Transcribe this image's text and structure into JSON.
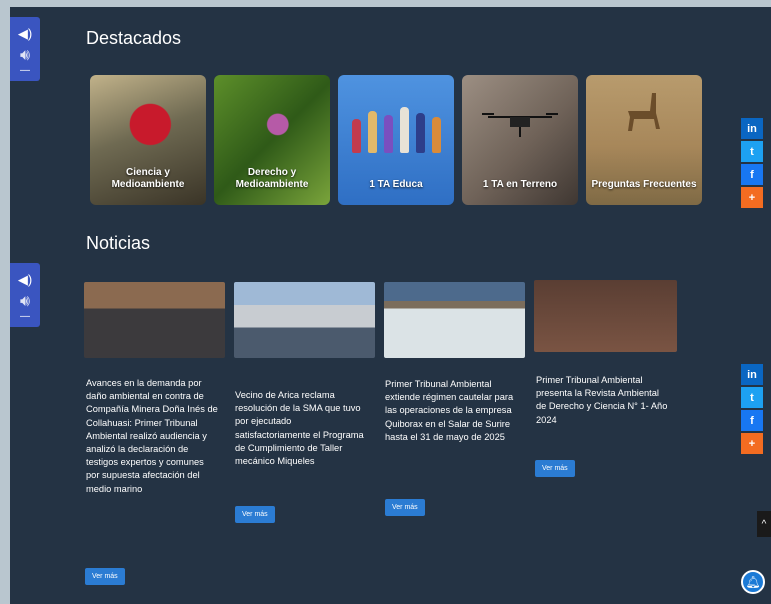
{
  "sections": {
    "featured_title": "Destacados",
    "news_title": "Noticias"
  },
  "accessibility": {
    "icon": "speaker-icon"
  },
  "featured": [
    {
      "label": "Ciencia y Medioambiente"
    },
    {
      "label": "Derecho y Medioambiente"
    },
    {
      "label": "1 TA Educa"
    },
    {
      "label": "1 TA en Terreno"
    },
    {
      "label": "Preguntas Frecuentes"
    }
  ],
  "news": [
    {
      "text": "Avances en la demanda por daño ambiental en contra de Compañía Minera Doña Inés de Collahuasi: Primer Tribunal Ambiental realizó audiencia y analizó la declaración de testigos expertos y comunes por supuesta afectación del medio marino",
      "button": "Ver más"
    },
    {
      "text": "Vecino de Arica reclama resolución de la SMA que tuvo por ejecutado satisfactoriamente el Programa de Cumplimiento de Taller mecánico Miqueles",
      "button": "Ver más"
    },
    {
      "text": "Primer Tribunal Ambiental extiende régimen cautelar para las operaciones de la empresa Quiborax en el Salar de Surire hasta el 31 de mayo de 2025",
      "button": "Ver más"
    },
    {
      "text": "Primer Tribunal Ambiental presenta la Revista Ambiental de Derecho y Ciencia N° 1- Año 2024",
      "button": "Ver más"
    }
  ],
  "social": {
    "linkedin": "in",
    "twitter": "t",
    "facebook": "f",
    "share": "+"
  },
  "colors": {
    "background": "#243344",
    "button": "#2b7cd3",
    "accessibility": "#3a55c0",
    "share": "#f36c21"
  }
}
